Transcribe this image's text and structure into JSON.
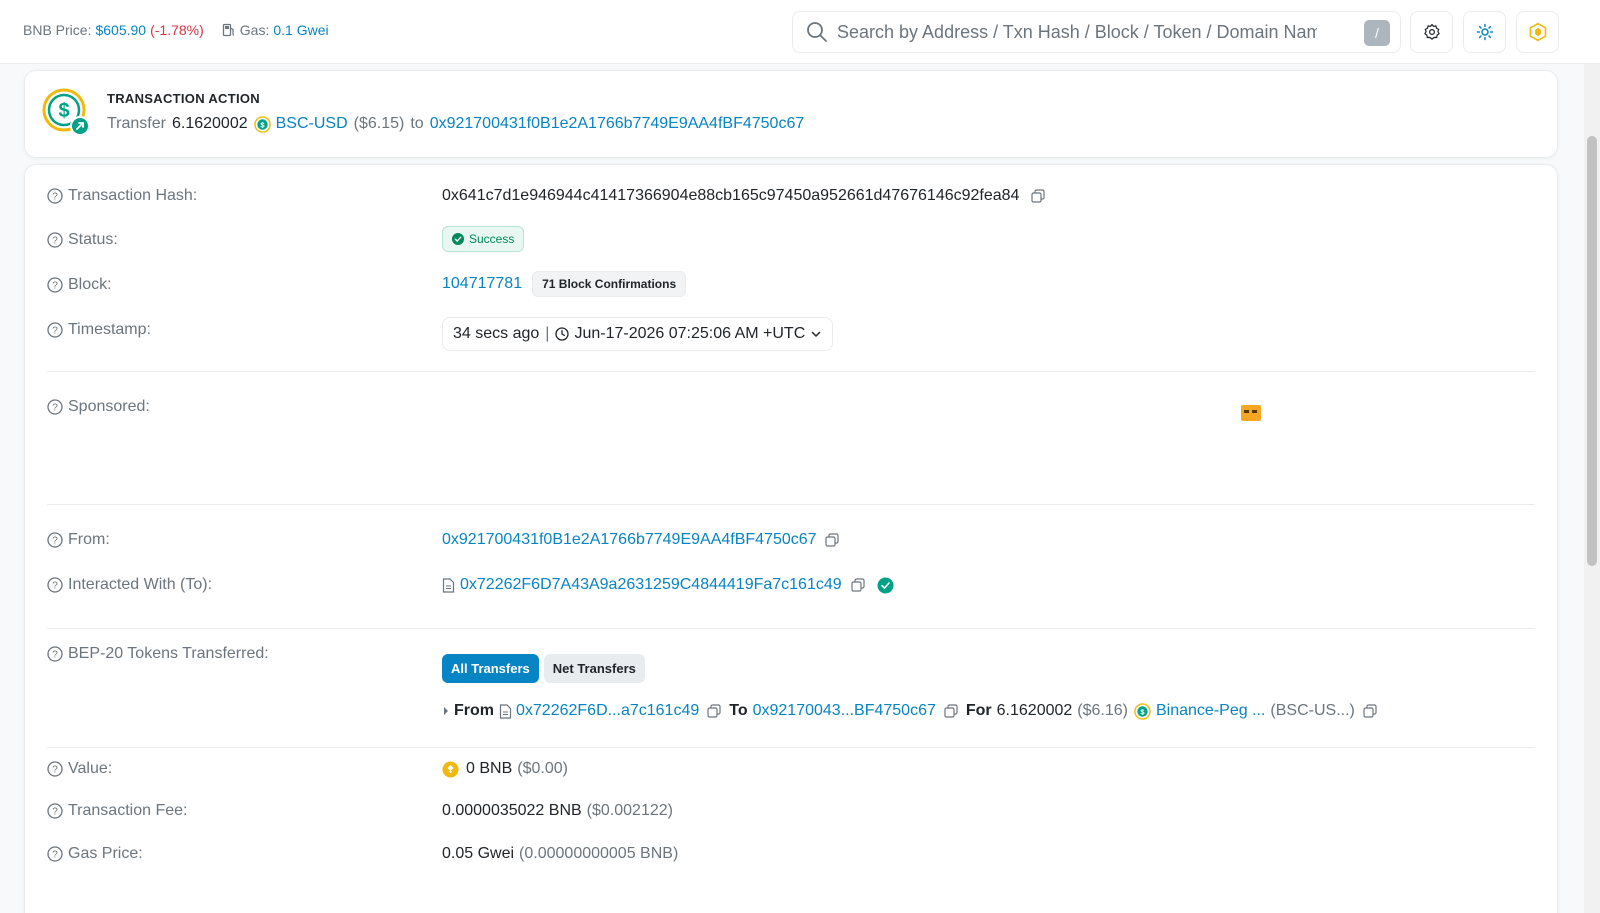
{
  "topbar": {
    "bnb_price_label": "BNB Price:",
    "bnb_price": "$605.90",
    "bnb_change": "(-1.78%)",
    "gas_label": "Gas:",
    "gas_value": "0.1 Gwei",
    "search_placeholder": "Search by Address / Txn Hash / Block / Token / Domain Name",
    "search_shortcut": "/"
  },
  "action": {
    "title": "TRANSACTION ACTION",
    "verb": "Transfer",
    "amount": "6.1620002",
    "token": "BSC-USD",
    "usd": "($6.15)",
    "to_word": "to",
    "to_address": "0x921700431f0B1e2A1766b7749E9AA4fBF4750c67"
  },
  "details": {
    "tx_hash_label": "Transaction Hash:",
    "tx_hash": "0x641c7d1e946944c41417366904e88cb165c97450a952661d47676146c92fea84",
    "status_label": "Status:",
    "status": "Success",
    "block_label": "Block:",
    "block": "104717781",
    "confirmations": "71 Block Confirmations",
    "timestamp_label": "Timestamp:",
    "timestamp_ago": "34 secs ago",
    "timestamp_sep": "|",
    "timestamp_full": "Jun-17-2026 07:25:06 AM +UTC",
    "sponsored_label": "Sponsored:",
    "from_label": "From:",
    "from": "0x921700431f0B1e2A1766b7749E9AA4fBF4750c67",
    "to_label": "Interacted With (To):",
    "to": "0x72262F6D7A43A9a2631259C4844419Fa7c161c49",
    "tokens_label": "BEP-20 Tokens Transferred:",
    "all_transfers": "All Transfers",
    "net_transfers": "Net Transfers",
    "transfer": {
      "from_word": "From",
      "from": "0x72262F6D...a7c161c49",
      "to_word": "To",
      "to": "0x92170043...BF4750c67",
      "for_word": "For",
      "amount": "6.1620002",
      "usd": "($6.16)",
      "token": "Binance-Peg ...",
      "symbol": "(BSC-US...)"
    },
    "value_label": "Value:",
    "value": "0 BNB",
    "value_usd": "($0.00)",
    "fee_label": "Transaction Fee:",
    "fee": "0.0000035022 BNB",
    "fee_usd": "($0.002122)",
    "gas_price_label": "Gas Price:",
    "gas_price": "0.05 Gwei",
    "gas_price_bnb": "(0.00000000005 BNB)"
  },
  "colors": {
    "link": "#0784c3",
    "success": "#00a186",
    "negative": "#dc3545",
    "bnb": "#f0b90b"
  }
}
